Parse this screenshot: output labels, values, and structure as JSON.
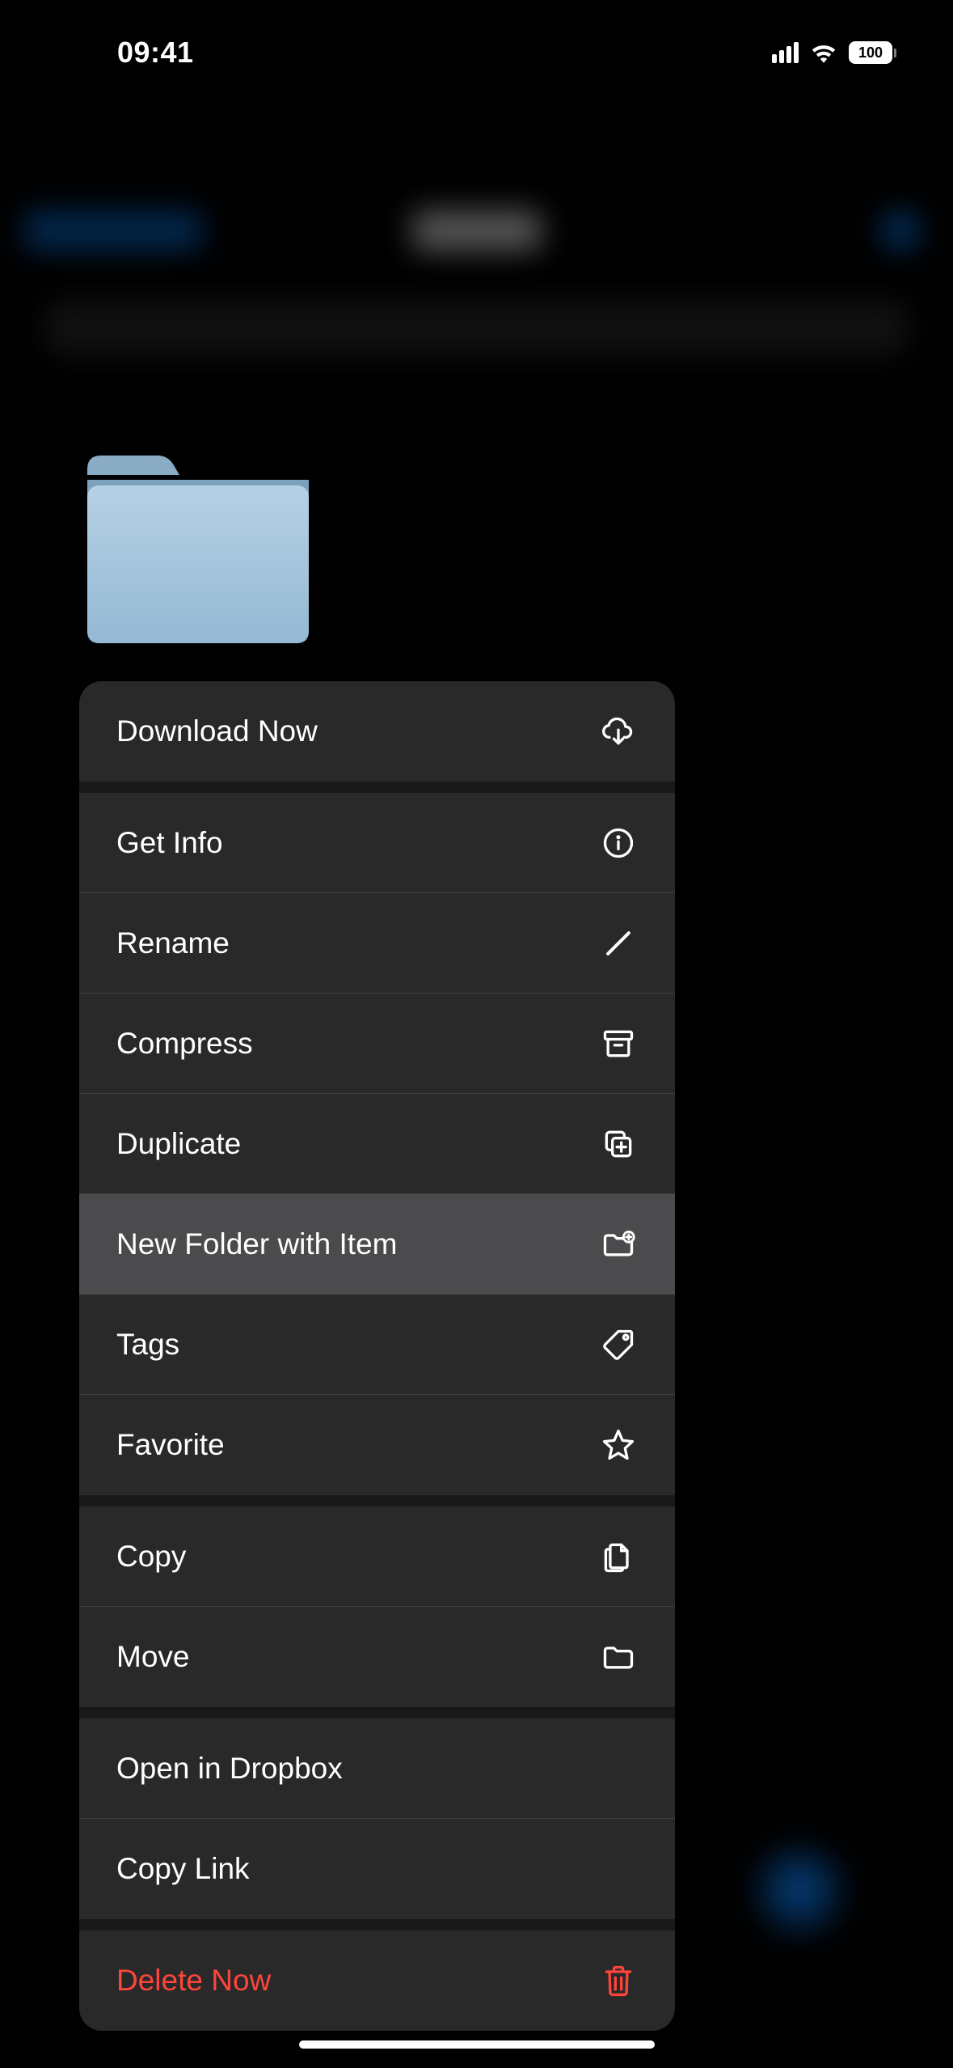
{
  "status_bar": {
    "time": "09:41",
    "battery": "100"
  },
  "context_menu": {
    "groups": [
      {
        "items": [
          {
            "label": "Download Now",
            "icon": "cloud-download-icon"
          }
        ]
      },
      {
        "items": [
          {
            "label": "Get Info",
            "icon": "info-icon"
          },
          {
            "label": "Rename",
            "icon": "pencil-icon"
          },
          {
            "label": "Compress",
            "icon": "archivebox-icon"
          },
          {
            "label": "Duplicate",
            "icon": "duplicate-icon"
          },
          {
            "label": "New Folder with Item",
            "icon": "folder-plus-icon",
            "highlighted": true
          },
          {
            "label": "Tags",
            "icon": "tag-icon"
          },
          {
            "label": "Favorite",
            "icon": "star-icon"
          }
        ]
      },
      {
        "items": [
          {
            "label": "Copy",
            "icon": "copy-icon"
          },
          {
            "label": "Move",
            "icon": "folder-icon"
          }
        ]
      },
      {
        "items": [
          {
            "label": "Open in Dropbox",
            "icon": ""
          },
          {
            "label": "Copy Link",
            "icon": ""
          }
        ]
      },
      {
        "items": [
          {
            "label": "Delete Now",
            "icon": "trash-icon",
            "destructive": true
          }
        ]
      }
    ]
  }
}
